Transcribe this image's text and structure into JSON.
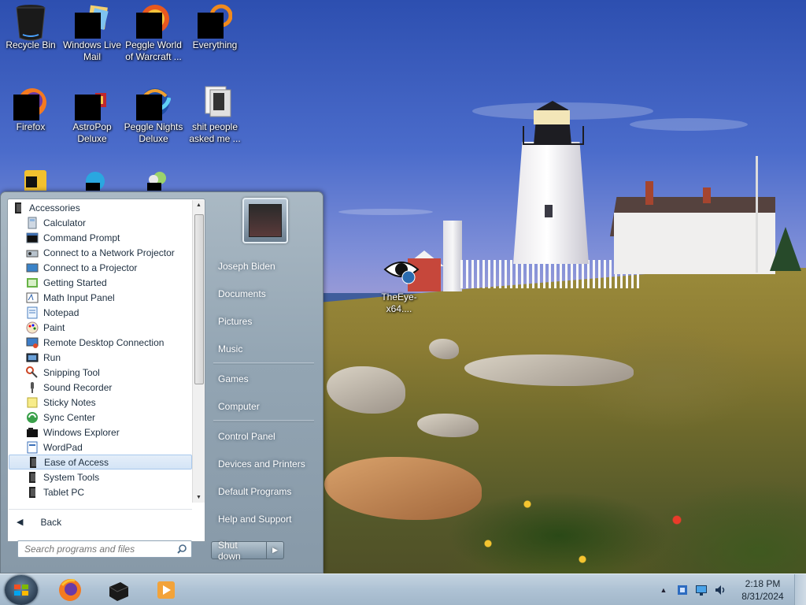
{
  "desktop": {
    "icons": [
      {
        "label": "Recycle Bin",
        "icon": "recycle-bin-icon"
      },
      {
        "label": "Windows Live Mail",
        "icon": "windows-live-mail-icon"
      },
      {
        "label": "Peggle World of Warcraft ...",
        "icon": "peggle-wow-icon"
      },
      {
        "label": "Everything",
        "icon": "everything-icon"
      },
      {
        "label": "Firefox",
        "icon": "firefox-icon"
      },
      {
        "label": "AstroPop Deluxe",
        "icon": "astropop-icon"
      },
      {
        "label": "Peggle Nights Deluxe",
        "icon": "peggle-nights-icon"
      },
      {
        "label": "shit people asked me ...",
        "icon": "folder-icon"
      },
      {
        "label": "TheEye-x64....",
        "icon": "eye-icon"
      }
    ]
  },
  "start_menu": {
    "folder_label": "Accessories",
    "programs": [
      {
        "label": "Calculator",
        "icon": "calculator-icon"
      },
      {
        "label": "Command Prompt",
        "icon": "command-prompt-icon"
      },
      {
        "label": "Connect to a Network Projector",
        "icon": "network-projector-icon"
      },
      {
        "label": "Connect to a Projector",
        "icon": "projector-icon"
      },
      {
        "label": "Getting Started",
        "icon": "getting-started-icon"
      },
      {
        "label": "Math Input Panel",
        "icon": "math-input-icon"
      },
      {
        "label": "Notepad",
        "icon": "notepad-icon"
      },
      {
        "label": "Paint",
        "icon": "paint-icon"
      },
      {
        "label": "Remote Desktop Connection",
        "icon": "remote-desktop-icon"
      },
      {
        "label": "Run",
        "icon": "run-icon"
      },
      {
        "label": "Snipping Tool",
        "icon": "snipping-tool-icon"
      },
      {
        "label": "Sound Recorder",
        "icon": "microphone-icon"
      },
      {
        "label": "Sticky Notes",
        "icon": "sticky-notes-icon"
      },
      {
        "label": "Sync Center",
        "icon": "sync-center-icon"
      },
      {
        "label": "Windows Explorer",
        "icon": "windows-explorer-icon"
      },
      {
        "label": "WordPad",
        "icon": "wordpad-icon"
      },
      {
        "label": "Ease of Access",
        "icon": "folder-icon"
      },
      {
        "label": "System Tools",
        "icon": "folder-icon"
      },
      {
        "label": "Tablet PC",
        "icon": "folder-icon"
      }
    ],
    "back_label": "Back",
    "search_placeholder": "Search programs and files",
    "right_links": [
      "Joseph Biden",
      "Documents",
      "Pictures",
      "Music",
      "Games",
      "Computer",
      "Control Panel",
      "Devices and Printers",
      "Default Programs",
      "Help and Support"
    ],
    "shutdown_label": "Shut down"
  },
  "taskbar": {
    "pinned": [
      "firefox-icon",
      "blackbox-icon",
      "media-player-icon"
    ],
    "tray_icons": [
      "show-hidden-icons-chevron",
      "tray-app-icon",
      "network-icon",
      "volume-icon"
    ],
    "clock_time": "2:18 PM",
    "clock_date": "8/31/2024"
  },
  "colors": {
    "highlight_border": "#a8c8ec",
    "menu_pane": "#ffffff",
    "taskbar": "#aec2d4"
  }
}
